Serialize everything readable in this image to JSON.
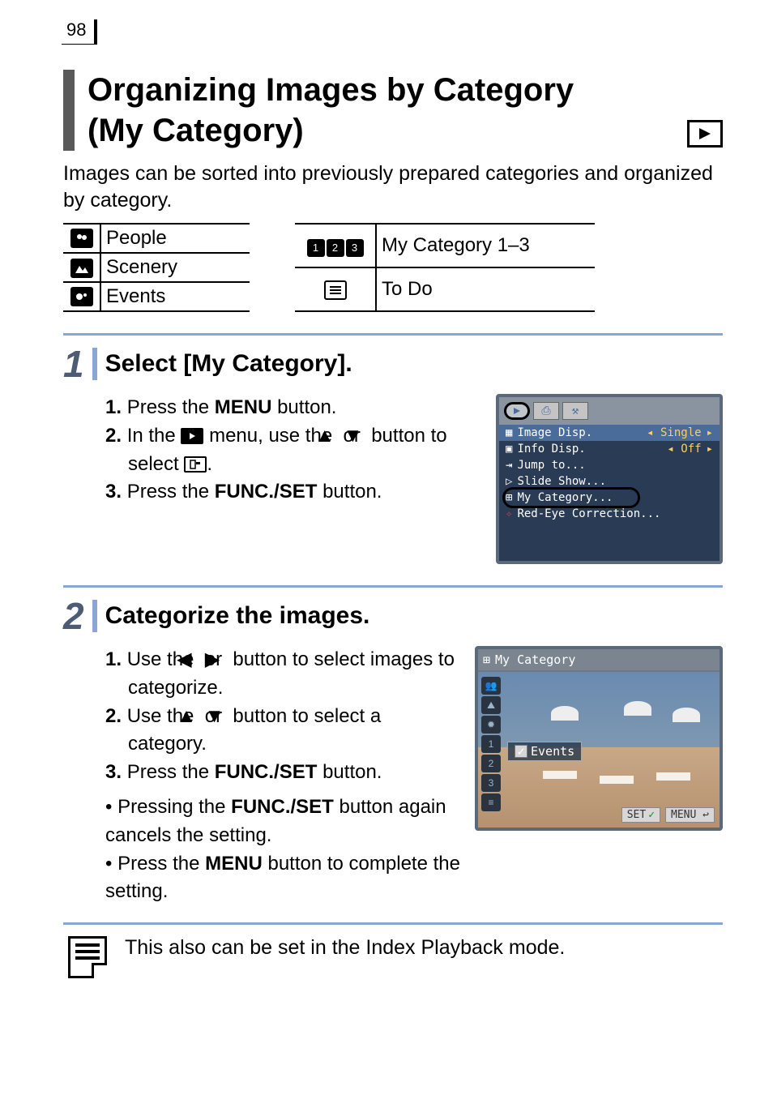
{
  "page_number": "98",
  "title_line1": "Organizing Images by Category",
  "title_line2": "(My Category)",
  "intro": "Images can be sorted into previously prepared categories and organized by category.",
  "category_table_left": [
    {
      "label": "People"
    },
    {
      "label": "Scenery"
    },
    {
      "label": "Events"
    }
  ],
  "category_table_right": [
    {
      "label": "My Category 1–3"
    },
    {
      "label": "To Do"
    }
  ],
  "step1": {
    "title": "Select [My Category].",
    "item1_a": "1.",
    "item1_b": "Press the ",
    "item1_c": "MENU",
    "item1_d": " button.",
    "item2_a": "2.",
    "item2_b": "In the ",
    "item2_c": " menu, use the ",
    "item2_d": " or ",
    "item2_e": " button to select ",
    "item2_f": ".",
    "item3_a": "3.",
    "item3_b": "Press the ",
    "item3_c": "FUNC./SET",
    "item3_d": " button."
  },
  "screen1": {
    "rows": [
      {
        "label": "Image Disp.",
        "value": "Single"
      },
      {
        "label": "Info Disp.",
        "value": "Off"
      },
      {
        "label": "Jump to...",
        "value": ""
      },
      {
        "label": "Slide Show...",
        "value": ""
      },
      {
        "label": "My Category...",
        "value": ""
      },
      {
        "label": "Red-Eye Correction...",
        "value": ""
      }
    ]
  },
  "step2": {
    "title": "Categorize the images.",
    "item1_a": "1.",
    "item1_b": "Use the ",
    "item1_c": " or ",
    "item1_d": " button to select images to categorize.",
    "item2_a": "2.",
    "item2_b": "Use the ",
    "item2_c": " or ",
    "item2_d": " button to select a category.",
    "item3_a": "3.",
    "item3_b": "Press the ",
    "item3_c": "FUNC./SET",
    "item3_d": " button.",
    "bullet1_a": "Pressing the ",
    "bullet1_b": "FUNC./SET",
    "bullet1_c": " button again cancels the setting.",
    "bullet2_a": "Press the ",
    "bullet2_b": "MENU",
    "bullet2_c": " button to complete the setting."
  },
  "screen2": {
    "title": "My Category",
    "events_label": "Events",
    "set_btn": "SET",
    "menu_btn": "MENU"
  },
  "note": "This also can be set in the Index Playback mode."
}
